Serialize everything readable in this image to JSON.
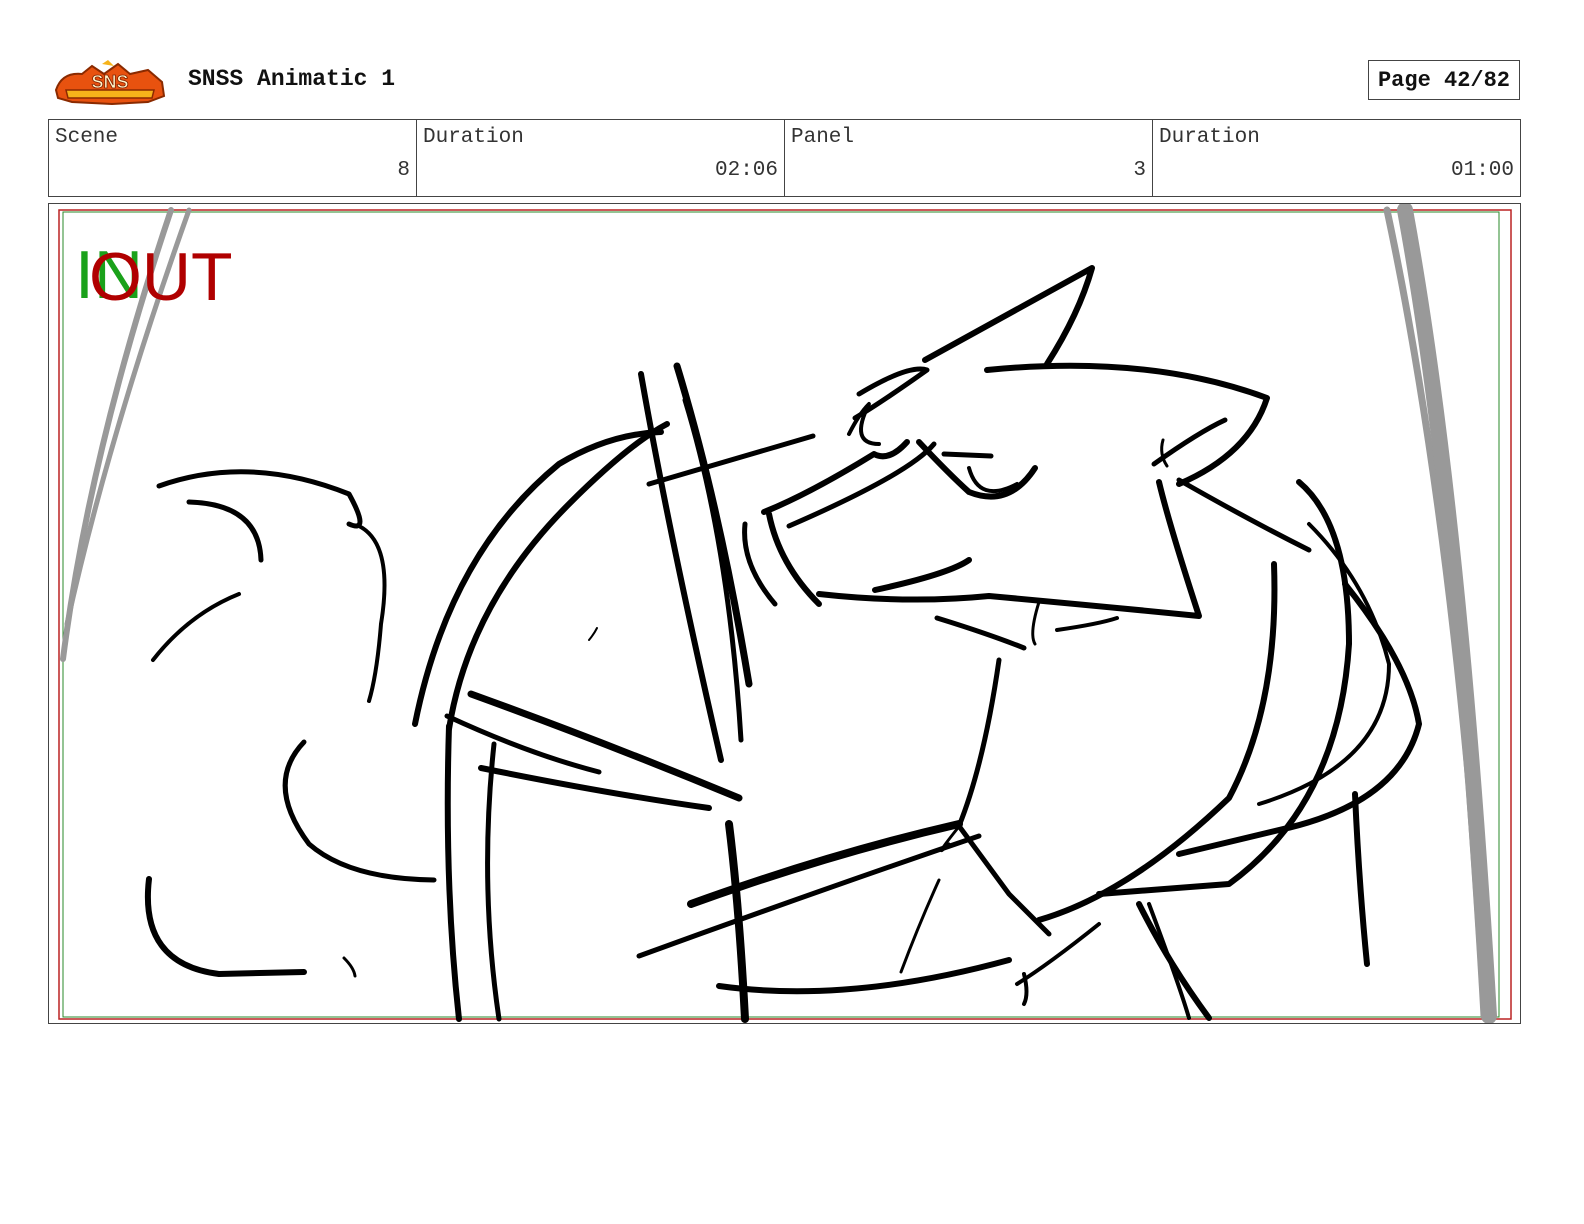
{
  "header": {
    "logo_text": "SNS",
    "title": "SNSS Animatic 1",
    "page": "Page 42/82"
  },
  "info": {
    "scene_label": "Scene",
    "scene_value": "8",
    "scene_duration_label": "Duration",
    "scene_duration_value": "02:06",
    "panel_label": "Panel",
    "panel_value": "3",
    "panel_duration_label": "Duration",
    "panel_duration_value": "01:00"
  },
  "panel": {
    "in_marker": "IN",
    "out_marker": "OUT",
    "in_color": "#1aa11a",
    "out_color": "#b00000"
  }
}
